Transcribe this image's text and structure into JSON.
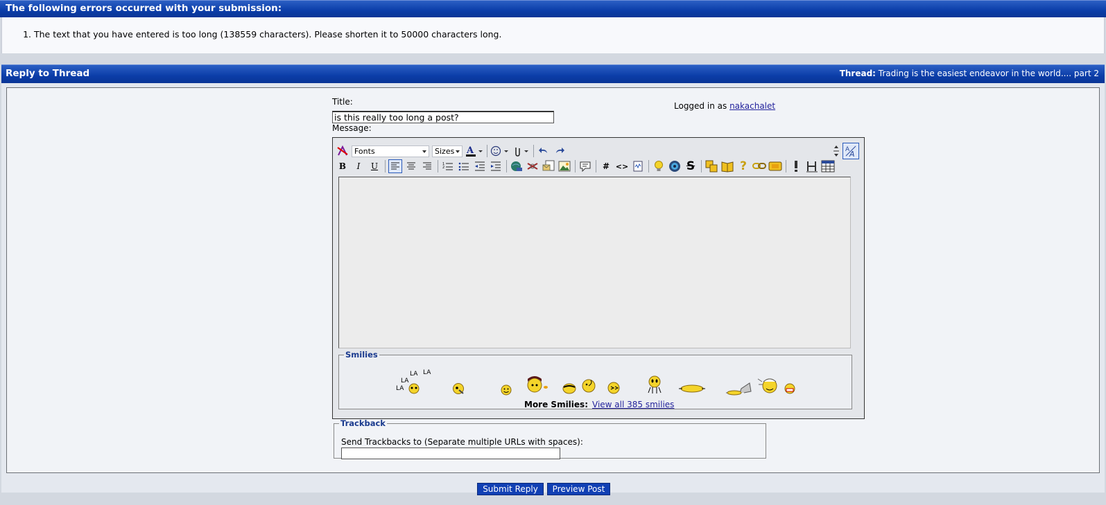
{
  "errors": {
    "header": "The following errors occurred with your submission:",
    "items": [
      "The text that you have entered is too long (138559 characters). Please shorten it to 50000 characters long."
    ]
  },
  "reply": {
    "header": "Reply to Thread",
    "thread_label": "Thread:",
    "thread_title": "Trading is the easiest endeavor in the world.... part 2"
  },
  "form": {
    "title_label": "Title:",
    "title_value": "is this really too long a post?",
    "message_label": "Message:",
    "logged_in_prefix": "Logged in as",
    "username": "nakachalet"
  },
  "toolbar": {
    "fonts": "Fonts",
    "sizes": "Sizes",
    "bold": "B",
    "italic": "I",
    "underline": "U",
    "hash": "#",
    "code": "<>"
  },
  "smilies": {
    "legend": "Smilies",
    "la1": "LA",
    "la2": "LA",
    "la3": "LA",
    "la4": "LA",
    "more_label": "More Smilies:",
    "view_all": "View all 385 smilies"
  },
  "trackback": {
    "legend": "Trackback",
    "label": "Send Trackbacks to (Separate multiple URLs with spaces):"
  },
  "buttons": {
    "submit": "Submit Reply",
    "preview": "Preview Post"
  }
}
